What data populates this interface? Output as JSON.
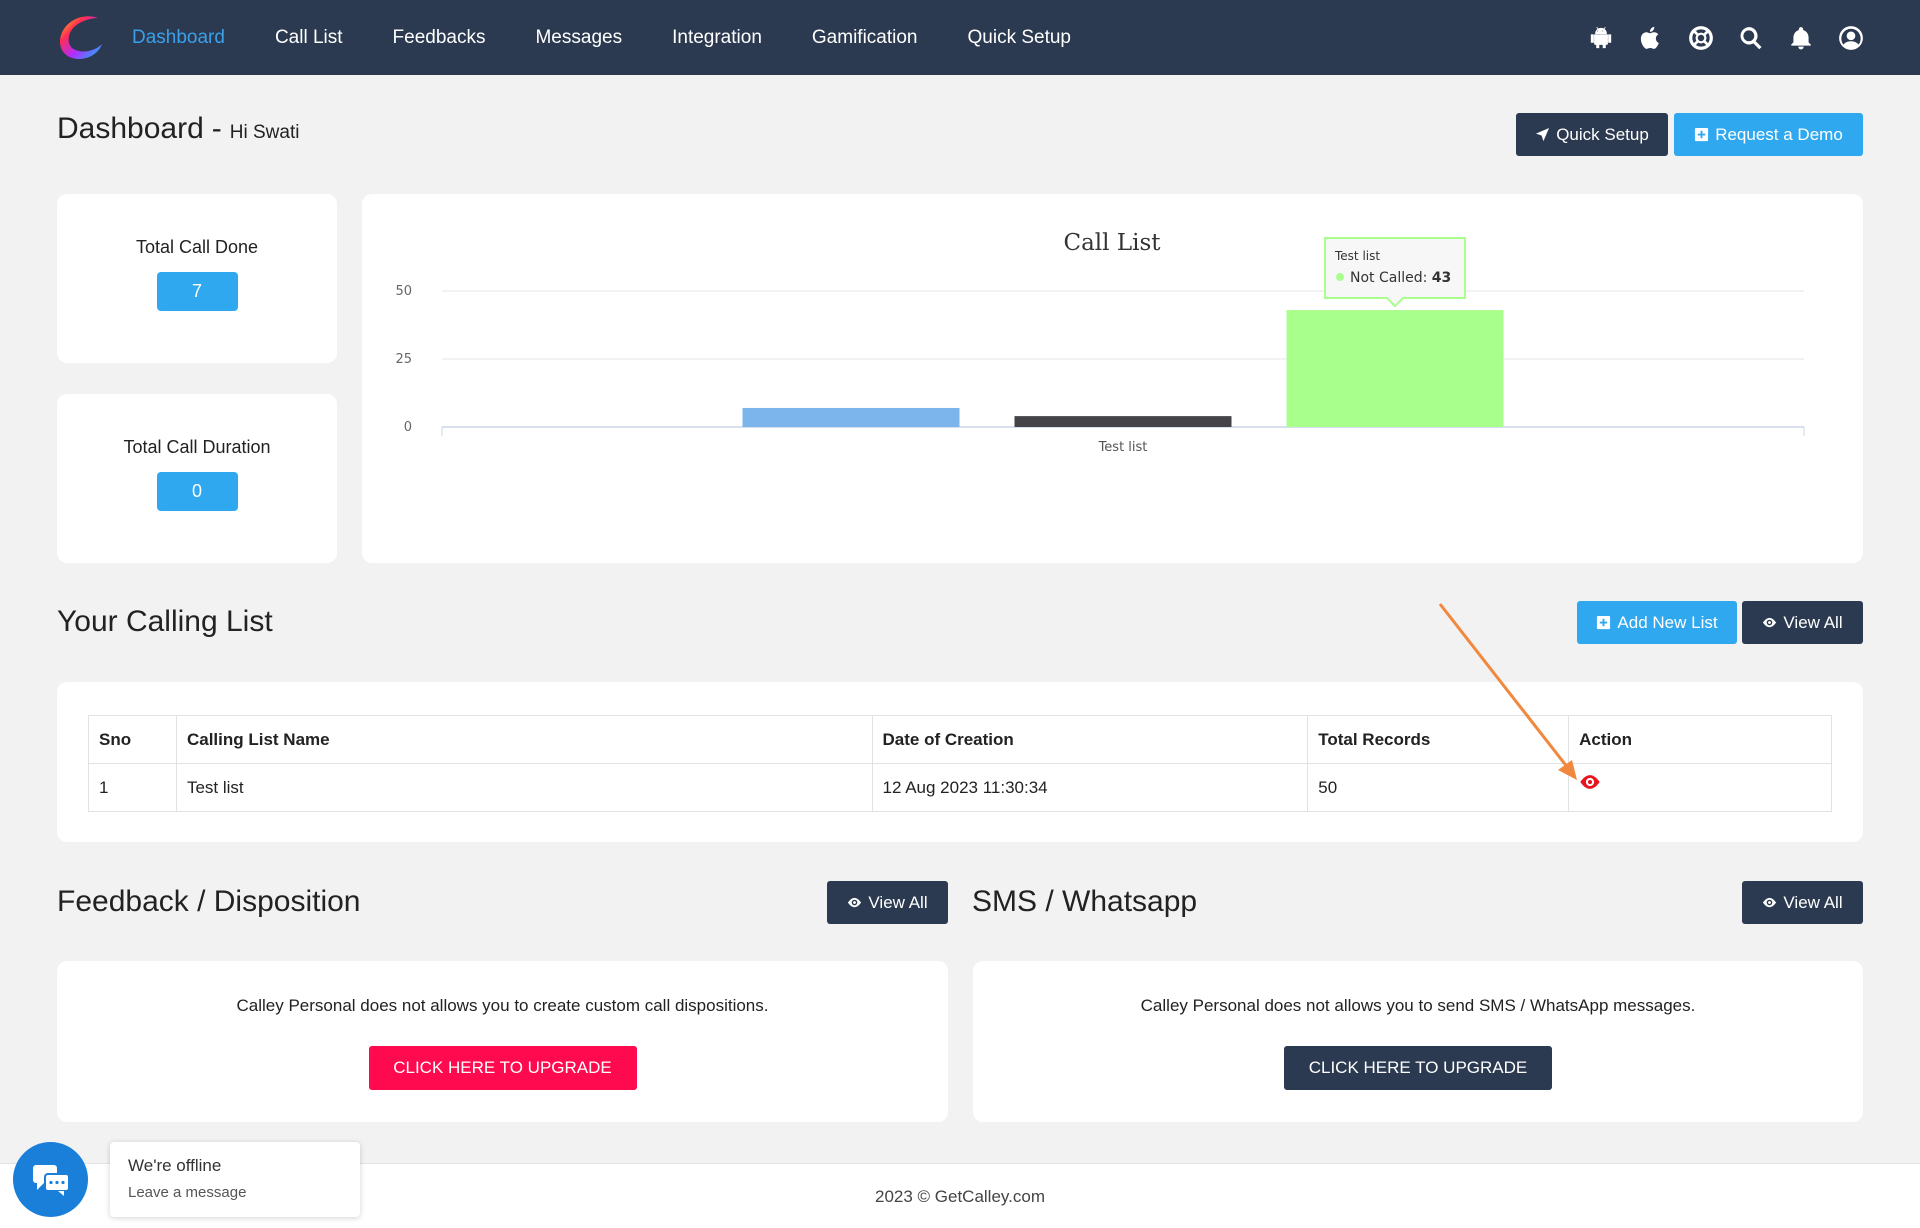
{
  "nav": {
    "items": [
      {
        "label": "Dashboard",
        "active": true
      },
      {
        "label": "Call List"
      },
      {
        "label": "Feedbacks"
      },
      {
        "label": "Messages"
      },
      {
        "label": "Integration"
      },
      {
        "label": "Gamification"
      },
      {
        "label": "Quick Setup"
      }
    ],
    "icons": [
      "android-icon",
      "apple-icon",
      "help-lifebuoy-icon",
      "search-icon",
      "bell-icon",
      "user-icon"
    ]
  },
  "header": {
    "title": "Dashboard",
    "dash": "-",
    "greeting": "Hi Swati",
    "quick_setup_label": "Quick Setup",
    "request_demo_label": "Request a Demo"
  },
  "stats": {
    "total_call_done_label": "Total Call Done",
    "total_call_done_value": "7",
    "total_call_duration_label": "Total Call Duration",
    "total_call_duration_value": "0"
  },
  "chart_data": {
    "type": "bar",
    "title": "Call List",
    "categories": [
      "Test list"
    ],
    "ylim": [
      0,
      50
    ],
    "yticks": [
      0,
      25,
      50
    ],
    "series": [
      {
        "values": [
          7
        ],
        "color": "#7cb5ec"
      },
      {
        "values": [
          4
        ],
        "color": "#434348"
      },
      {
        "name": "Not Called",
        "values": [
          43
        ],
        "color": "#a9ff8c"
      }
    ],
    "tooltip": {
      "category": "Test list",
      "series": "Not Called",
      "value": "43"
    },
    "grid": true,
    "legend": false
  },
  "calling_list": {
    "title": "Your Calling List",
    "add_label": "Add New List",
    "view_all_label": "View All",
    "columns": [
      "Sno",
      "Calling List Name",
      "Date of Creation",
      "Total Records",
      "Action"
    ],
    "rows": [
      {
        "sno": "1",
        "name": "Test list",
        "date": "12 Aug 2023 11:30:34",
        "records": "50",
        "action_icon": "eye-icon"
      }
    ]
  },
  "feedback": {
    "title": "Feedback / Disposition",
    "view_all_label": "View All",
    "message": "Calley Personal does not allows you to create custom call dispositions.",
    "upgrade_label": "CLICK HERE TO UPGRADE"
  },
  "sms": {
    "title": "SMS / Whatsapp",
    "view_all_label": "View All",
    "message": "Calley Personal does not allows you to send SMS / WhatsApp messages.",
    "upgrade_label": "CLICK HERE TO UPGRADE"
  },
  "footer": {
    "text": "2023 © GetCalley.com"
  },
  "chat": {
    "title": "We're offline",
    "subtitle": "Leave a message"
  },
  "colors": {
    "nav_bg": "#2b3a50",
    "accent_blue": "#2fa8f0",
    "upgrade_red": "#ff0a4f",
    "annotation_orange": "#f0883e",
    "action_eye_red": "#e8141e"
  }
}
